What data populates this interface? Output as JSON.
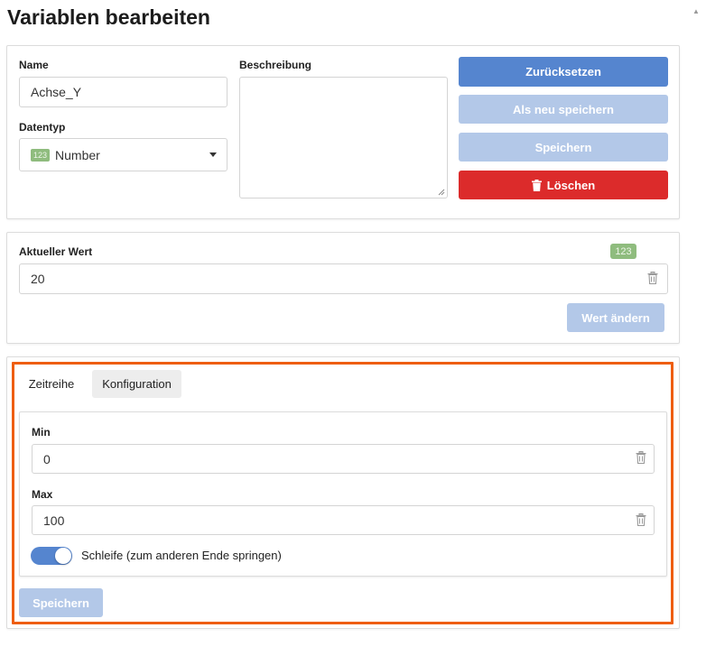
{
  "header": {
    "title": "Variablen bearbeiten"
  },
  "variable": {
    "name_label": "Name",
    "name_value": "Achse_Y",
    "datatype_label": "Datentyp",
    "datatype_badge": "123",
    "datatype_value": "Number",
    "description_label": "Beschreibung",
    "description_value": ""
  },
  "actions": {
    "reset_label": "Zurücksetzen",
    "save_as_new_label": "Als neu speichern",
    "save_label": "Speichern",
    "delete_label": "Löschen"
  },
  "current_value": {
    "label": "Aktueller Wert",
    "type_badge": "123",
    "value": "20",
    "change_label": "Wert ändern"
  },
  "config": {
    "tabs": [
      {
        "label": "Zeitreihe",
        "active": true
      },
      {
        "label": "Konfiguration",
        "active": false
      }
    ],
    "min_label": "Min",
    "min_value": "0",
    "max_label": "Max",
    "max_value": "100",
    "loop_label": "Schleife (zum anderen Ende springen)",
    "loop_enabled": true,
    "save_label": "Speichern"
  },
  "colors": {
    "primary": "#5585cf",
    "primary_disabled": "#b3c8e8",
    "danger": "#dc2b2b",
    "badge": "#8fbc7e",
    "highlight": "#ee5e12"
  },
  "icons": {
    "trash": "trash-icon",
    "caret": "chevron-down-icon",
    "scroll": "scroll-up-icon"
  }
}
